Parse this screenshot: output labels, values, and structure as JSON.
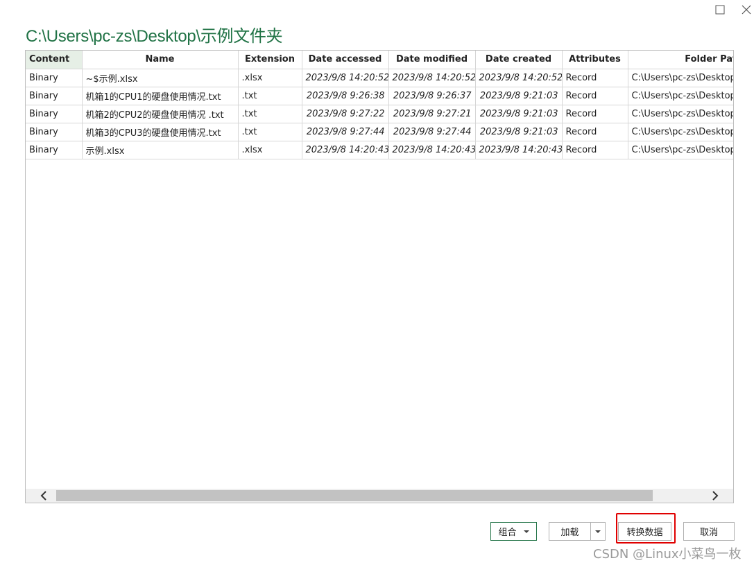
{
  "title": "C:\\Users\\pc-zs\\Desktop\\示例文件夹",
  "columns": [
    "Content",
    "Name",
    "Extension",
    "Date accessed",
    "Date modified",
    "Date created",
    "Attributes",
    "Folder Path"
  ],
  "rows": [
    [
      "Binary",
      "~$示例.xlsx",
      ".xlsx",
      "2023/9/8 14:20:52",
      "2023/9/8 14:20:52",
      "2023/9/8 14:20:52",
      "Record",
      "C:\\Users\\pc-zs\\Desktop\\"
    ],
    [
      "Binary",
      "机箱1的CPU1的硬盘使用情况.txt",
      ".txt",
      "2023/9/8 9:26:38",
      "2023/9/8 9:26:37",
      "2023/9/8 9:21:03",
      "Record",
      "C:\\Users\\pc-zs\\Desktop\\"
    ],
    [
      "Binary",
      "机箱2的CPU2的硬盘使用情况 .txt",
      ".txt",
      "2023/9/8 9:27:22",
      "2023/9/8 9:27:21",
      "2023/9/8 9:21:03",
      "Record",
      "C:\\Users\\pc-zs\\Desktop\\"
    ],
    [
      "Binary",
      "机箱3的CPU3的硬盘使用情况.txt",
      ".txt",
      "2023/9/8 9:27:44",
      "2023/9/8 9:27:44",
      "2023/9/8 9:21:03",
      "Record",
      "C:\\Users\\pc-zs\\Desktop\\"
    ],
    [
      "Binary",
      "示例.xlsx",
      ".xlsx",
      "2023/9/8 14:20:43",
      "2023/9/8 14:20:43",
      "2023/9/8 14:20:43",
      "Record",
      "C:\\Users\\pc-zs\\Desktop\\"
    ]
  ],
  "buttons": {
    "combine": "组合",
    "load": "加载",
    "transform": "转换数据",
    "cancel": "取消"
  },
  "watermark": "CSDN @Linux小菜鸟一枚",
  "icons": {
    "maximize": "maximize-icon",
    "close": "close-icon",
    "scroll_left": "chevron-left-icon",
    "scroll_right": "chevron-right-icon",
    "dropdown": "caret-down-icon"
  },
  "colors": {
    "title": "#217346",
    "selected_column": "#e6efe6",
    "highlight": "#e00000"
  }
}
